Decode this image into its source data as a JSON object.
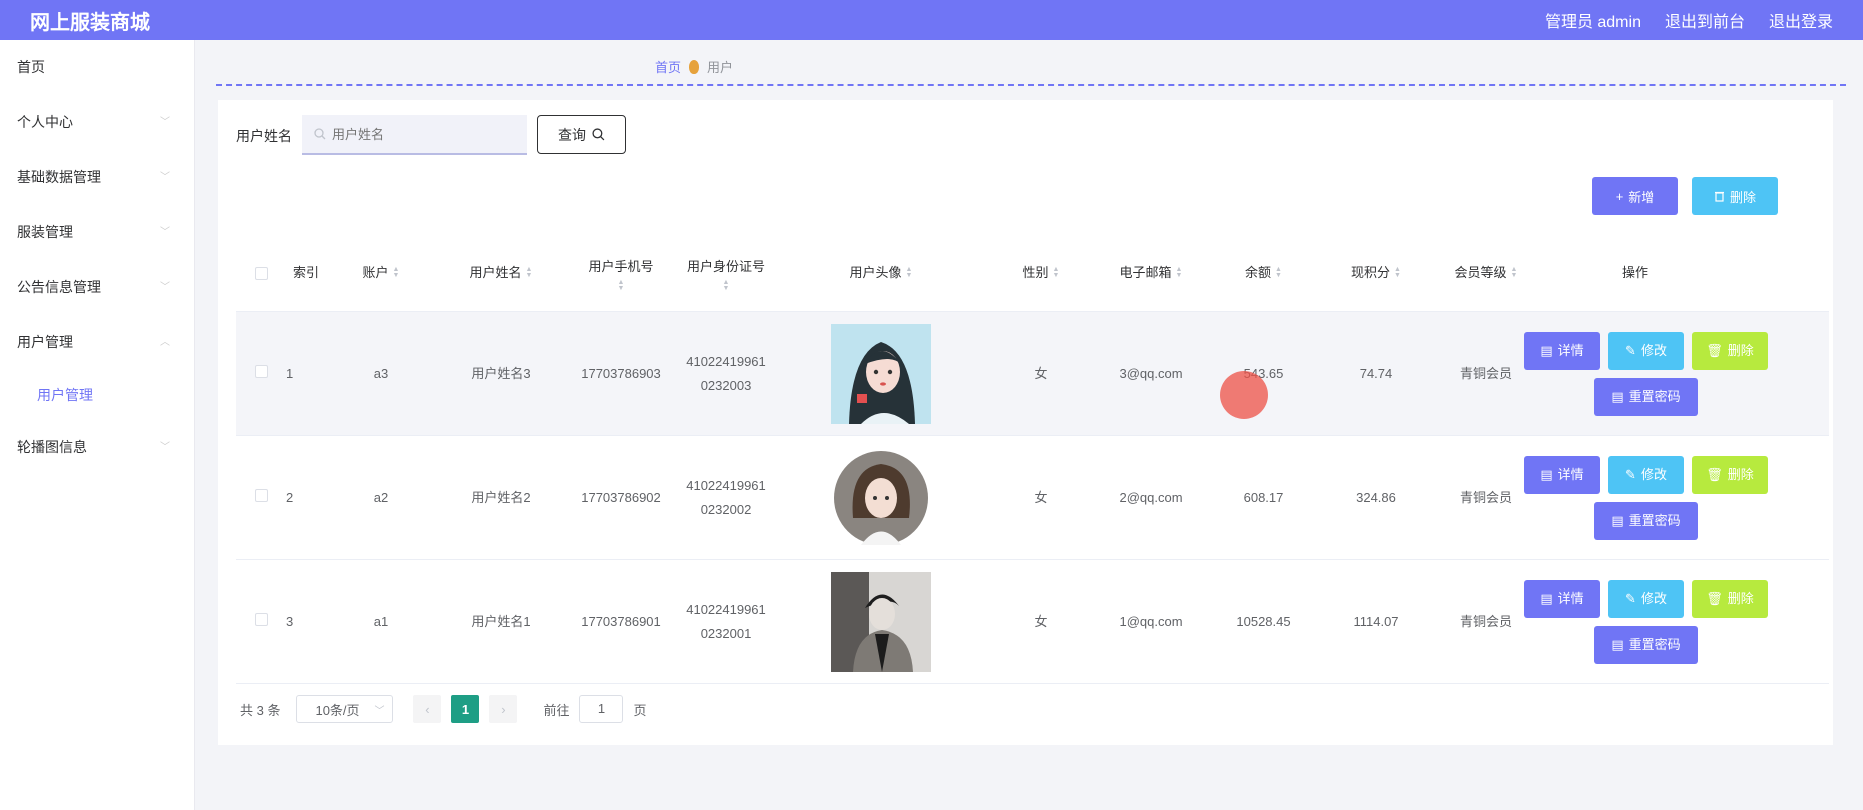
{
  "header": {
    "brand": "网上服装商城",
    "user": "管理员 admin",
    "to_front": "退出到前台",
    "logout": "退出登录"
  },
  "sidebar": {
    "items": [
      {
        "label": "首页"
      },
      {
        "label": "个人中心"
      },
      {
        "label": "基础数据管理"
      },
      {
        "label": "服装管理"
      },
      {
        "label": "公告信息管理"
      },
      {
        "label": "用户管理"
      },
      {
        "label": "用户管理",
        "sub": true
      },
      {
        "label": "轮播图信息"
      }
    ]
  },
  "breadcrumb": {
    "home": "首页",
    "current": "用户"
  },
  "search": {
    "label": "用户姓名",
    "placeholder": "用户姓名",
    "button": "查询"
  },
  "actions": {
    "add": "新增",
    "delete": "删除"
  },
  "table": {
    "headers": [
      "索引",
      "账户",
      "用户姓名",
      "用户手机号",
      "用户身份证号",
      "用户头像",
      "性别",
      "电子邮箱",
      "余额",
      "现积分",
      "会员等级",
      "操作"
    ],
    "rows": [
      {
        "index": "1",
        "account": "a3",
        "name": "用户姓名3",
        "phone": "17703786903",
        "id_line1": "41022419961",
        "id_line2": "0232003",
        "gender": "女",
        "email": "3@qq.com",
        "balance": "543.65",
        "points": "74.74",
        "level": "青铜会员"
      },
      {
        "index": "2",
        "account": "a2",
        "name": "用户姓名2",
        "phone": "17703786902",
        "id_line1": "41022419961",
        "id_line2": "0232002",
        "gender": "女",
        "email": "2@qq.com",
        "balance": "608.17",
        "points": "324.86",
        "level": "青铜会员"
      },
      {
        "index": "3",
        "account": "a1",
        "name": "用户姓名1",
        "phone": "17703786901",
        "id_line1": "41022419961",
        "id_line2": "0232001",
        "gender": "女",
        "email": "1@qq.com",
        "balance": "10528.45",
        "points": "1114.07",
        "level": "青铜会员"
      }
    ],
    "op_labels": {
      "detail": "详情",
      "edit": "修改",
      "delete": "删除",
      "reset": "重置密码"
    }
  },
  "pagination": {
    "total": "共 3 条",
    "page_size": "10条/页",
    "current": "1",
    "goto_prefix": "前往",
    "goto_value": "1",
    "goto_suffix": "页"
  },
  "colors": {
    "primary": "#7075f5",
    "info": "#4ec4f5",
    "warning": "#b7ea3e",
    "page_active": "#1e9e85"
  }
}
